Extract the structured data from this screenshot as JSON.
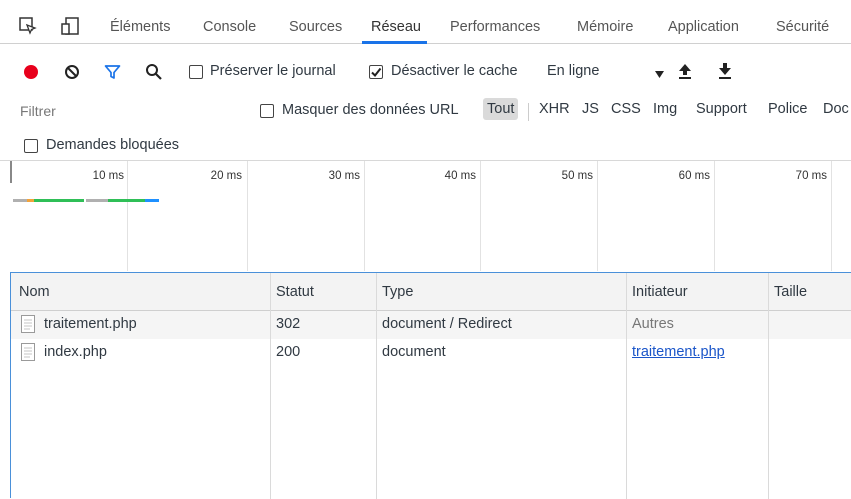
{
  "tabs": [
    {
      "label": "Éléments"
    },
    {
      "label": "Console"
    },
    {
      "label": "Sources"
    },
    {
      "label": "Réseau"
    },
    {
      "label": "Performances"
    },
    {
      "label": "Mémoire"
    },
    {
      "label": "Application"
    },
    {
      "label": "Sécurité"
    }
  ],
  "active_tab": "Réseau",
  "toolbar": {
    "preserve_log_label": "Préserver le journal",
    "preserve_log_checked": false,
    "disable_cache_label": "Désactiver le cache",
    "disable_cache_checked": true,
    "throttling_value": "En ligne"
  },
  "filter": {
    "placeholder": "Filtrer",
    "hide_data_urls_label": "Masquer des données URL",
    "types": [
      "Tout",
      "XHR",
      "JS",
      "CSS",
      "Img",
      "Support",
      "Police",
      "Doc"
    ],
    "selected_type": "Tout"
  },
  "blocked_requests_label": "Demandes bloquées",
  "overview": {
    "ticks": [
      "10 ms",
      "20 ms",
      "30 ms",
      "40 ms",
      "50 ms",
      "60 ms",
      "70 ms"
    ]
  },
  "colors": {
    "accent": "#1a73e8",
    "record": "#e8001c",
    "filter_icon": "#1a73e8",
    "link": "#1a55c9",
    "waiting_bar": "#2fbf57",
    "download_bar": "#1e90ff",
    "stalled_bar": "#b0b0b0",
    "queue_bar": "#f2a33a"
  },
  "table": {
    "columns": [
      "Nom",
      "Statut",
      "Type",
      "Initiateur",
      "Taille"
    ],
    "rows": [
      {
        "name": "traitement.php",
        "status": "302",
        "type": "document / Redirect",
        "initiator": "Autres",
        "initiator_is_link": false,
        "size": ""
      },
      {
        "name": "index.php",
        "status": "200",
        "type": "document",
        "initiator": "traitement.php",
        "initiator_is_link": true,
        "size": ""
      }
    ]
  }
}
